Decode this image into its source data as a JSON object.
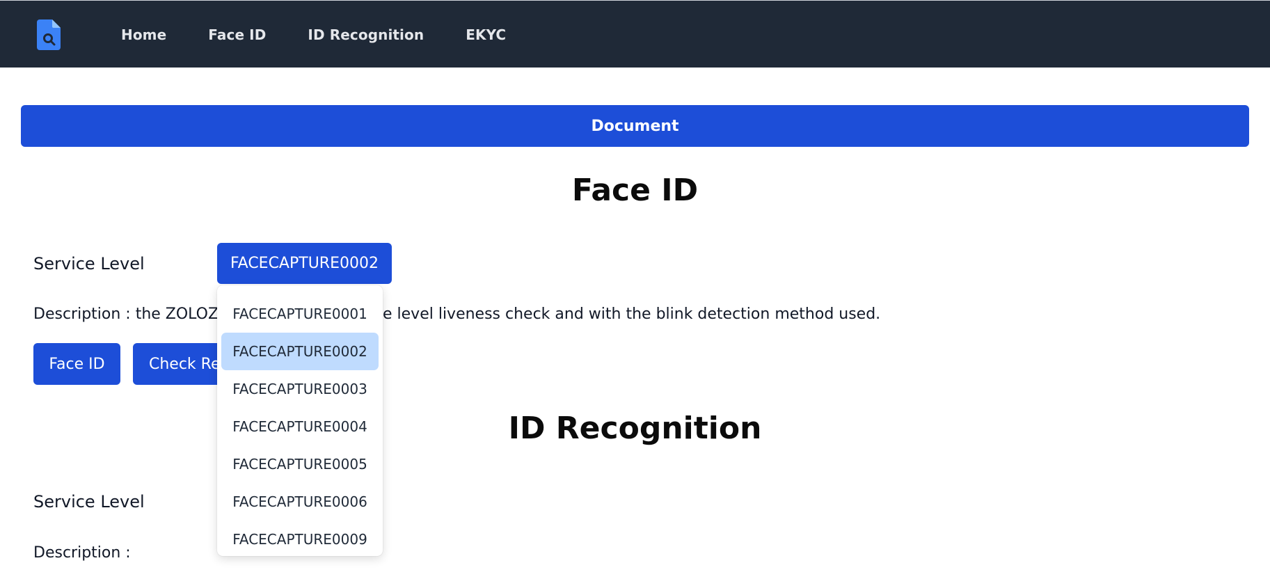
{
  "nav": {
    "links": [
      "Home",
      "Face ID",
      "ID Recognition",
      "EKYC"
    ]
  },
  "document_label": "Document",
  "face_id": {
    "title": "Face ID",
    "service_level_label": "Service Level",
    "selected_level": "FACECAPTURE0002",
    "description_left": "Description : the ZOLOZ s",
    "description_right": "e level liveness check and with the blink detection method used.",
    "face_id_button": "Face ID",
    "check_result_button": "Check Re",
    "dropdown_options": [
      "FACECAPTURE0001",
      "FACECAPTURE0002",
      "FACECAPTURE0003",
      "FACECAPTURE0004",
      "FACECAPTURE0005",
      "FACECAPTURE0006",
      "FACECAPTURE0009"
    ],
    "dropdown_selected_index": 1
  },
  "id_recognition": {
    "title": "ID Recognition",
    "service_level_label": "Service Level",
    "description_label": "Description :"
  },
  "colors": {
    "navbar": "#1f2937",
    "primary": "#1d4ed8",
    "selected_option": "#bfdbfe"
  }
}
